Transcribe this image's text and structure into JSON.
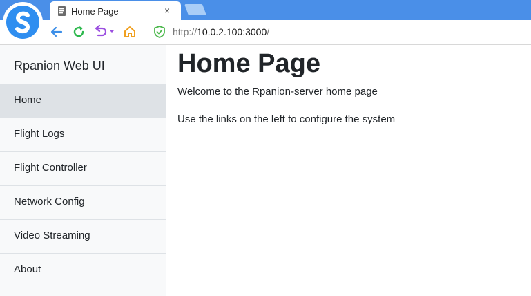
{
  "browser": {
    "tab": {
      "title": "Home Page",
      "close_glyph": "×"
    },
    "address": {
      "protocol": "http://",
      "host": "10.0.2.100:3000",
      "path": "/"
    },
    "icons": [
      "browser-logo-icon",
      "document-icon",
      "close-icon",
      "new-tab-icon",
      "back-arrow-icon",
      "refresh-icon",
      "undo-dropdown-icon",
      "home-icon",
      "security-shield-icon"
    ],
    "colors": {
      "tabstrip": "#4a8fe8",
      "back": "#3b8ee8",
      "refresh": "#2db84d",
      "undo": "#9b4fe0",
      "home": "#f0a020",
      "shield": "#4cb84c"
    }
  },
  "sidebar": {
    "brand": "Rpanion Web UI",
    "items": [
      {
        "label": "Home",
        "active": true
      },
      {
        "label": "Flight Logs",
        "active": false
      },
      {
        "label": "Flight Controller",
        "active": false
      },
      {
        "label": "Network Config",
        "active": false
      },
      {
        "label": "Video Streaming",
        "active": false
      },
      {
        "label": "About",
        "active": false
      }
    ]
  },
  "main": {
    "title": "Home Page",
    "paragraphs": [
      "Welcome to the Rpanion-server home page",
      "Use the links on the left to configure the system"
    ]
  }
}
